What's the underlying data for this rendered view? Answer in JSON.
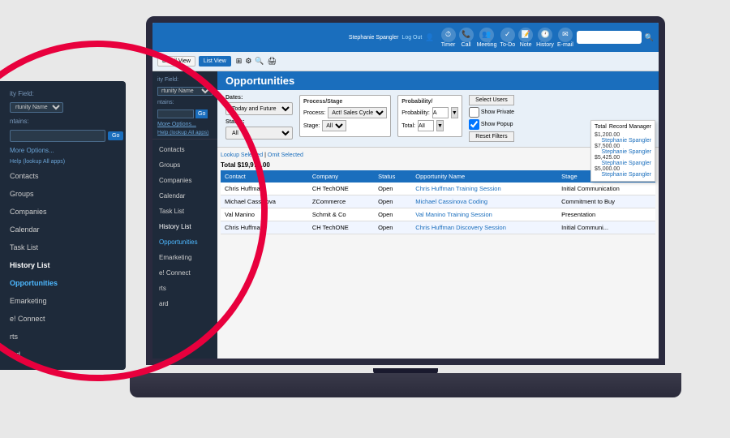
{
  "page": {
    "title": "Opportunities",
    "background": "#e8e8e8"
  },
  "topbar": {
    "user": "Stephanie Spangler",
    "logout": "Log Out",
    "search_placeholder": "Search",
    "icons": [
      "Timer",
      "Call",
      "Meeting",
      "To-Do",
      "Note",
      "History",
      "E-mail"
    ]
  },
  "toolbar2": {
    "views": [
      "Detail View",
      "List View"
    ],
    "active_view": "List View"
  },
  "nav": {
    "field_label": "ity Field:",
    "field_select": "rtunity Name",
    "contains_label": "ntains:",
    "go_button": "Go",
    "more_options": "More Options...",
    "help_link": "Help (lookup All apps)",
    "items": [
      {
        "label": "Contacts",
        "active": false
      },
      {
        "label": "Groups",
        "active": false
      },
      {
        "label": "Companies",
        "active": false
      },
      {
        "label": "Calendar",
        "active": false
      },
      {
        "label": "Task List",
        "active": false
      },
      {
        "label": "History List",
        "active": false
      },
      {
        "label": "Opportunities",
        "active": true
      },
      {
        "label": "Emarketing",
        "active": false
      },
      {
        "label": "e! Connect",
        "active": false
      },
      {
        "label": "rts",
        "active": false
      },
      {
        "label": "ard",
        "active": false
      }
    ]
  },
  "filters": {
    "dates_label": "Dates:",
    "dates_value": "Today and Future",
    "status_label": "Status:",
    "status_value": "All",
    "process_stage_title": "Process/Stage",
    "process_label": "Process:",
    "process_value": "Act! Sales Cycle",
    "stage_label": "Stage:",
    "stage_value": "All",
    "probability_title": "Probability/",
    "probability_label": "Probability:",
    "probability_value": "A",
    "total_label": "Total:",
    "total_value": "All",
    "selected_users": "Select Users",
    "show_private": "Show Private",
    "show_popup": "Show Popup",
    "reset_filters": "Reset Filters"
  },
  "table": {
    "lookup_selected": "Lookup Selected",
    "omit_selected": "Omit Selected",
    "total": "Total $19,975.00",
    "headers": [
      "Contact",
      "Company",
      "Status",
      "Opportunity Name",
      "Stage"
    ],
    "rows": [
      {
        "contact": "Chris Huffman",
        "company": "CH TechONE",
        "status": "Open",
        "opportunity_name": "Chris Huffman Training Session",
        "stage": "Initial Communication",
        "record_manager": "Stephanie Spangler",
        "total": "$1,200.00"
      },
      {
        "contact": "Michael Cassinova",
        "company": "ZCommerce",
        "status": "Open",
        "opportunity_name": "Michael Cassinova Coding",
        "stage": "Commitment to Buy",
        "record_manager": "Stephanie Spangler",
        "total": "$7,500.00"
      },
      {
        "contact": "Val Manino",
        "company": "Schmit & Co",
        "status": "Open",
        "opportunity_name": "Val Manino Training Session",
        "stage": "Presentation",
        "record_manager": "Stephanie Spangler",
        "total": "$5,425.00"
      },
      {
        "contact": "Chris Huffman",
        "company": "CH TechONE",
        "status": "Open",
        "opportunity_name": "Chris Huffman Discovery Session",
        "stage": "Initial Communi...",
        "record_manager": "Stephanie Spangler",
        "total": "$5,000.00"
      }
    ]
  },
  "right_panel": {
    "total_header": "Total",
    "record_manager_header": "Record Manager"
  }
}
